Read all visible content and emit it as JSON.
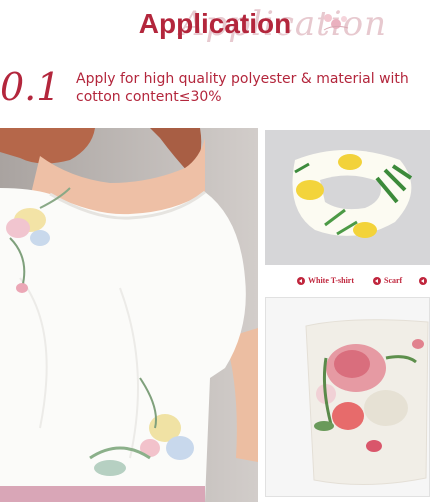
{
  "header": {
    "title": "Application",
    "script_watermark": "Application"
  },
  "point": {
    "number": "0.1",
    "text": "Apply for high quality polyester & material with cotton content≤30%"
  },
  "images": {
    "shirt": "floral-print-white-tshirt-photo",
    "scarf": "floral-scarf-hair-tie-photo",
    "pillow": "floral-print-cushion-photo"
  },
  "labels": {
    "white_tshirt": "White T-shirt",
    "scarf": "Scarf"
  },
  "colors": {
    "accent": "#b3263c",
    "watermark": "#e7c9cf"
  }
}
